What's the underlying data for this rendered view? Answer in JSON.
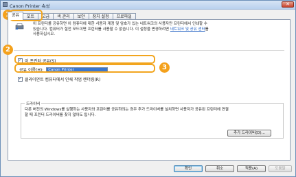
{
  "window": {
    "title": "Canon Printer 속성",
    "close_label": "✕"
  },
  "tabs": [
    "공유",
    "포트",
    "고급",
    "색 관리",
    "보안",
    "장치 설정",
    "프로파일"
  ],
  "sharing": {
    "description": "이 프린터를 공유하면 이 컴퓨터에 대한 사용자 계정 및 암호가 있는 네트워크의 사용자만 프린터에서 인쇄할 수 있습니다. 컴퓨터가 절전 모드이면 프린터를 사용할 수 없습니다. 이 설정을 변경하려면",
    "link": "네트워크 및 공유 센터",
    "link_suffix": "를 사용하십시오.",
    "share_checkbox": "이 프린터 공유(S)",
    "share_name_label": "공유 이름(H):",
    "share_name_value": "Canon Printer",
    "render_checkbox": "클라이언트 컴퓨터에서 인쇄 작업 렌더링(R)"
  },
  "drivers": {
    "group_label": "드라이버",
    "text": "다른 버전의 Windows를 실행하는 사용자와 프린터를 공유하려는 경우 추가 드라이버를 설치하면 사용자가 공유된 프린터에 연결할 때 프린터 드라이버를 찾지 않아도 됩니다.",
    "button": "추가 드라이버(D)..."
  },
  "footer": {
    "ok": "확인",
    "cancel": "취소",
    "apply": "적용(A)",
    "help": "도움말"
  },
  "markers": [
    "1",
    "2",
    "3"
  ],
  "colors": {
    "marker": "#f4a11c",
    "selection": "#3a77d0",
    "link": "#1f5fc2"
  }
}
